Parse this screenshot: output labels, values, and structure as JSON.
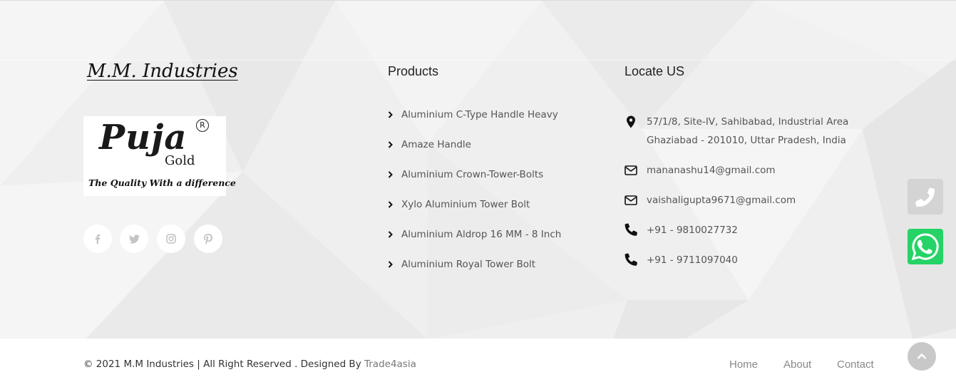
{
  "brand": {
    "title": "M.M. Industries",
    "logo_wordmark": "Puja",
    "logo_reg": "R",
    "logo_sub": "Gold",
    "logo_tagline": "The Quality With a difference"
  },
  "social": [
    {
      "name": "facebook",
      "glyph": "f"
    },
    {
      "name": "twitter",
      "glyph": "t"
    },
    {
      "name": "instagram",
      "glyph": "i"
    },
    {
      "name": "pinterest",
      "glyph": "p"
    }
  ],
  "products": {
    "heading": "Products",
    "items": [
      "Aluminium C-Type Handle Heavy",
      "Amaze Handle",
      "Aluminium Crown-Tower-Bolts",
      "Xylo Aluminium Tower Bolt",
      "Aluminium Aldrop 16 MM - 8 Inch",
      "Aluminium Royal Tower Bolt"
    ]
  },
  "locate": {
    "heading": "Locate US",
    "address_line1": "57/1/8, Site-IV, Sahibabad, Industrial Area",
    "address_line2": "Ghaziabad - 201010, Uttar Pradesh, India",
    "email1": "mananashu14@gmail.com",
    "email2": "vaishaligupta9671@gmail.com",
    "phone1": "+91 - 9810027732",
    "phone2": "+91 - 9711097040"
  },
  "footer": {
    "copyright": "© 2021 M.M Industries | All Right Reserved . Designed By ",
    "credit": "Trade4asia",
    "nav": [
      "Home",
      "About",
      "Contact"
    ]
  },
  "colors": {
    "whatsapp": "#25d366",
    "background": "#efefef"
  },
  "icons": {
    "product_bullet": "chevron-right-icon",
    "address": "map-marker-icon",
    "email": "envelope-icon",
    "phone": "phone-icon",
    "float_phone": "phone-icon",
    "float_whatsapp": "whatsapp-icon",
    "scroll_top": "chevron-up-icon"
  }
}
